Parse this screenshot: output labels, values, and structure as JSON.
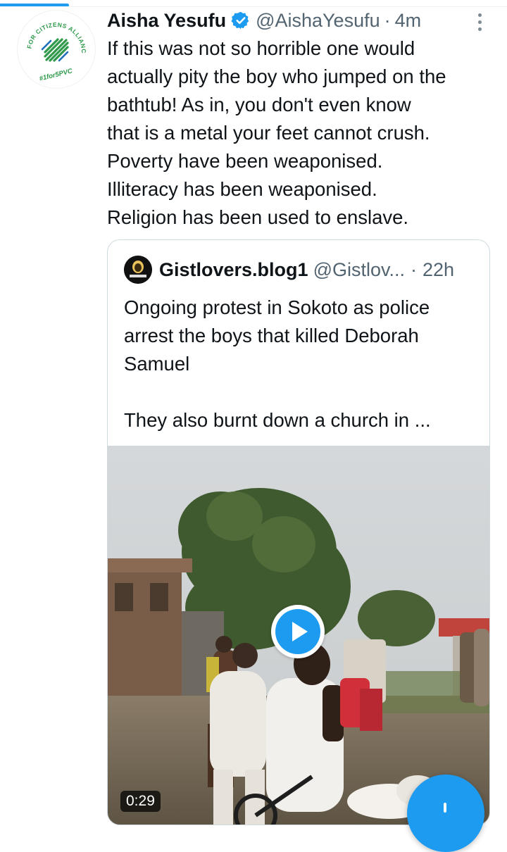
{
  "tweet": {
    "author_name": "Aisha Yesufu",
    "handle": "@AishaYesufu",
    "separator": "·",
    "time": "4m",
    "lines": [
      "If this was not so horrible one would",
      "actually pity the boy who jumped on the",
      "bathtub! As in, you don't even know",
      "that is a metal your feet cannot crush.",
      "Poverty have been weaponised.",
      "Illiteracy has been weaponised.",
      "Religion has been used to enslave."
    ],
    "avatar": {
      "icon": "for-citizens-alliance-logo",
      "arc_text": "FOR CITIZENS ALLIANCE",
      "tagline": "#1for5PVC",
      "accent": "#2e9a4a"
    }
  },
  "quoted": {
    "author_name": "Gistlovers.blog1",
    "handle": "@Gistlov...",
    "separator": "·",
    "time": "22h",
    "lines": [
      "Ongoing protest in Sokoto as police",
      "arrest the boys that killed Deborah",
      "Samuel",
      "",
      "They also burnt down a church in ..."
    ],
    "video": {
      "duration": "0:29",
      "icon": "play-icon"
    }
  },
  "colors": {
    "accent": "#1d9bf0",
    "text": "#0f1419",
    "muted": "#536471",
    "border": "#cfd9de"
  }
}
